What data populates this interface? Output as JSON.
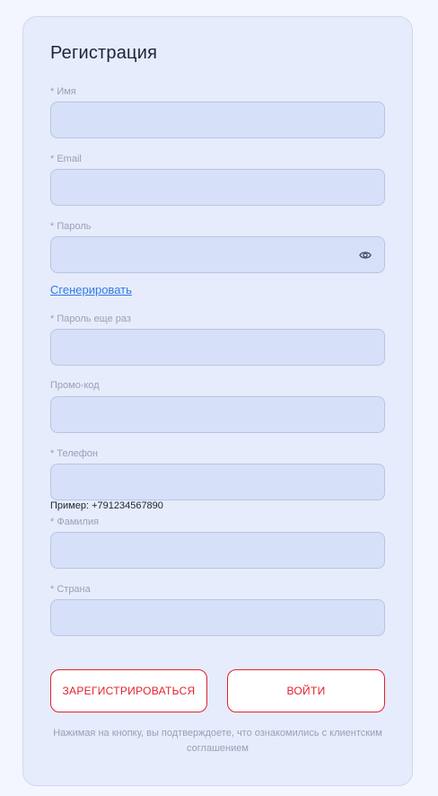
{
  "form": {
    "title": "Регистрация",
    "fields": {
      "name": {
        "label": "* Имя",
        "value": ""
      },
      "email": {
        "label": "* Email",
        "value": ""
      },
      "password": {
        "label": "* Пароль",
        "value": ""
      },
      "password_repeat": {
        "label": "* Пароль еще раз",
        "value": ""
      },
      "promo": {
        "label": "Промо-код",
        "value": ""
      },
      "phone": {
        "label": "* Телефон",
        "value": "",
        "hint": "Пример: +791234567890"
      },
      "surname": {
        "label": "* Фамилия",
        "value": ""
      },
      "country": {
        "label": "* Страна",
        "value": ""
      }
    },
    "generate_link": "Сгенерировать",
    "register_button": "ЗАРЕГИСТРИРОВАТЬСЯ",
    "login_button": "ВОЙТИ",
    "consent_text": "Нажимая на кнопку, вы подтверждоете, что ознакомились с клиентским соглашением"
  },
  "icons": {
    "password_toggle": "eye-icon"
  },
  "colors": {
    "accent": "#e2222b",
    "link": "#2f7be5",
    "card_bg": "#e6ecfc",
    "field_bg": "#d6e0f8"
  }
}
